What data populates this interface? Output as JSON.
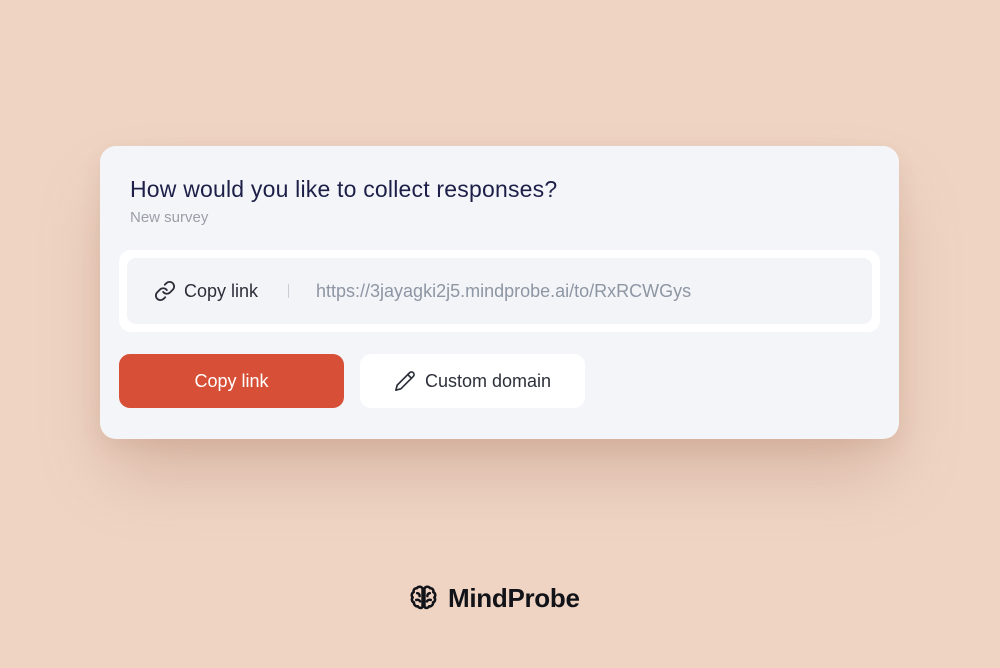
{
  "card": {
    "title": "How would you like to collect responses?",
    "subtitle": "New survey"
  },
  "link_box": {
    "copy_label": "Copy link",
    "copy_icon": "link-icon",
    "url": "https://3jayagki2j5.mindprobe.ai/to/RxRCWGys"
  },
  "actions": {
    "primary_label": "Copy link",
    "secondary_label": "Custom domain",
    "secondary_icon": "pencil-icon"
  },
  "brand": {
    "name": "MindProbe",
    "logo_icon": "brain-icon"
  },
  "colors": {
    "background": "#efd4c4",
    "card": "#f3f5f9",
    "accent": "#d64f36",
    "title": "#1d1f48"
  }
}
